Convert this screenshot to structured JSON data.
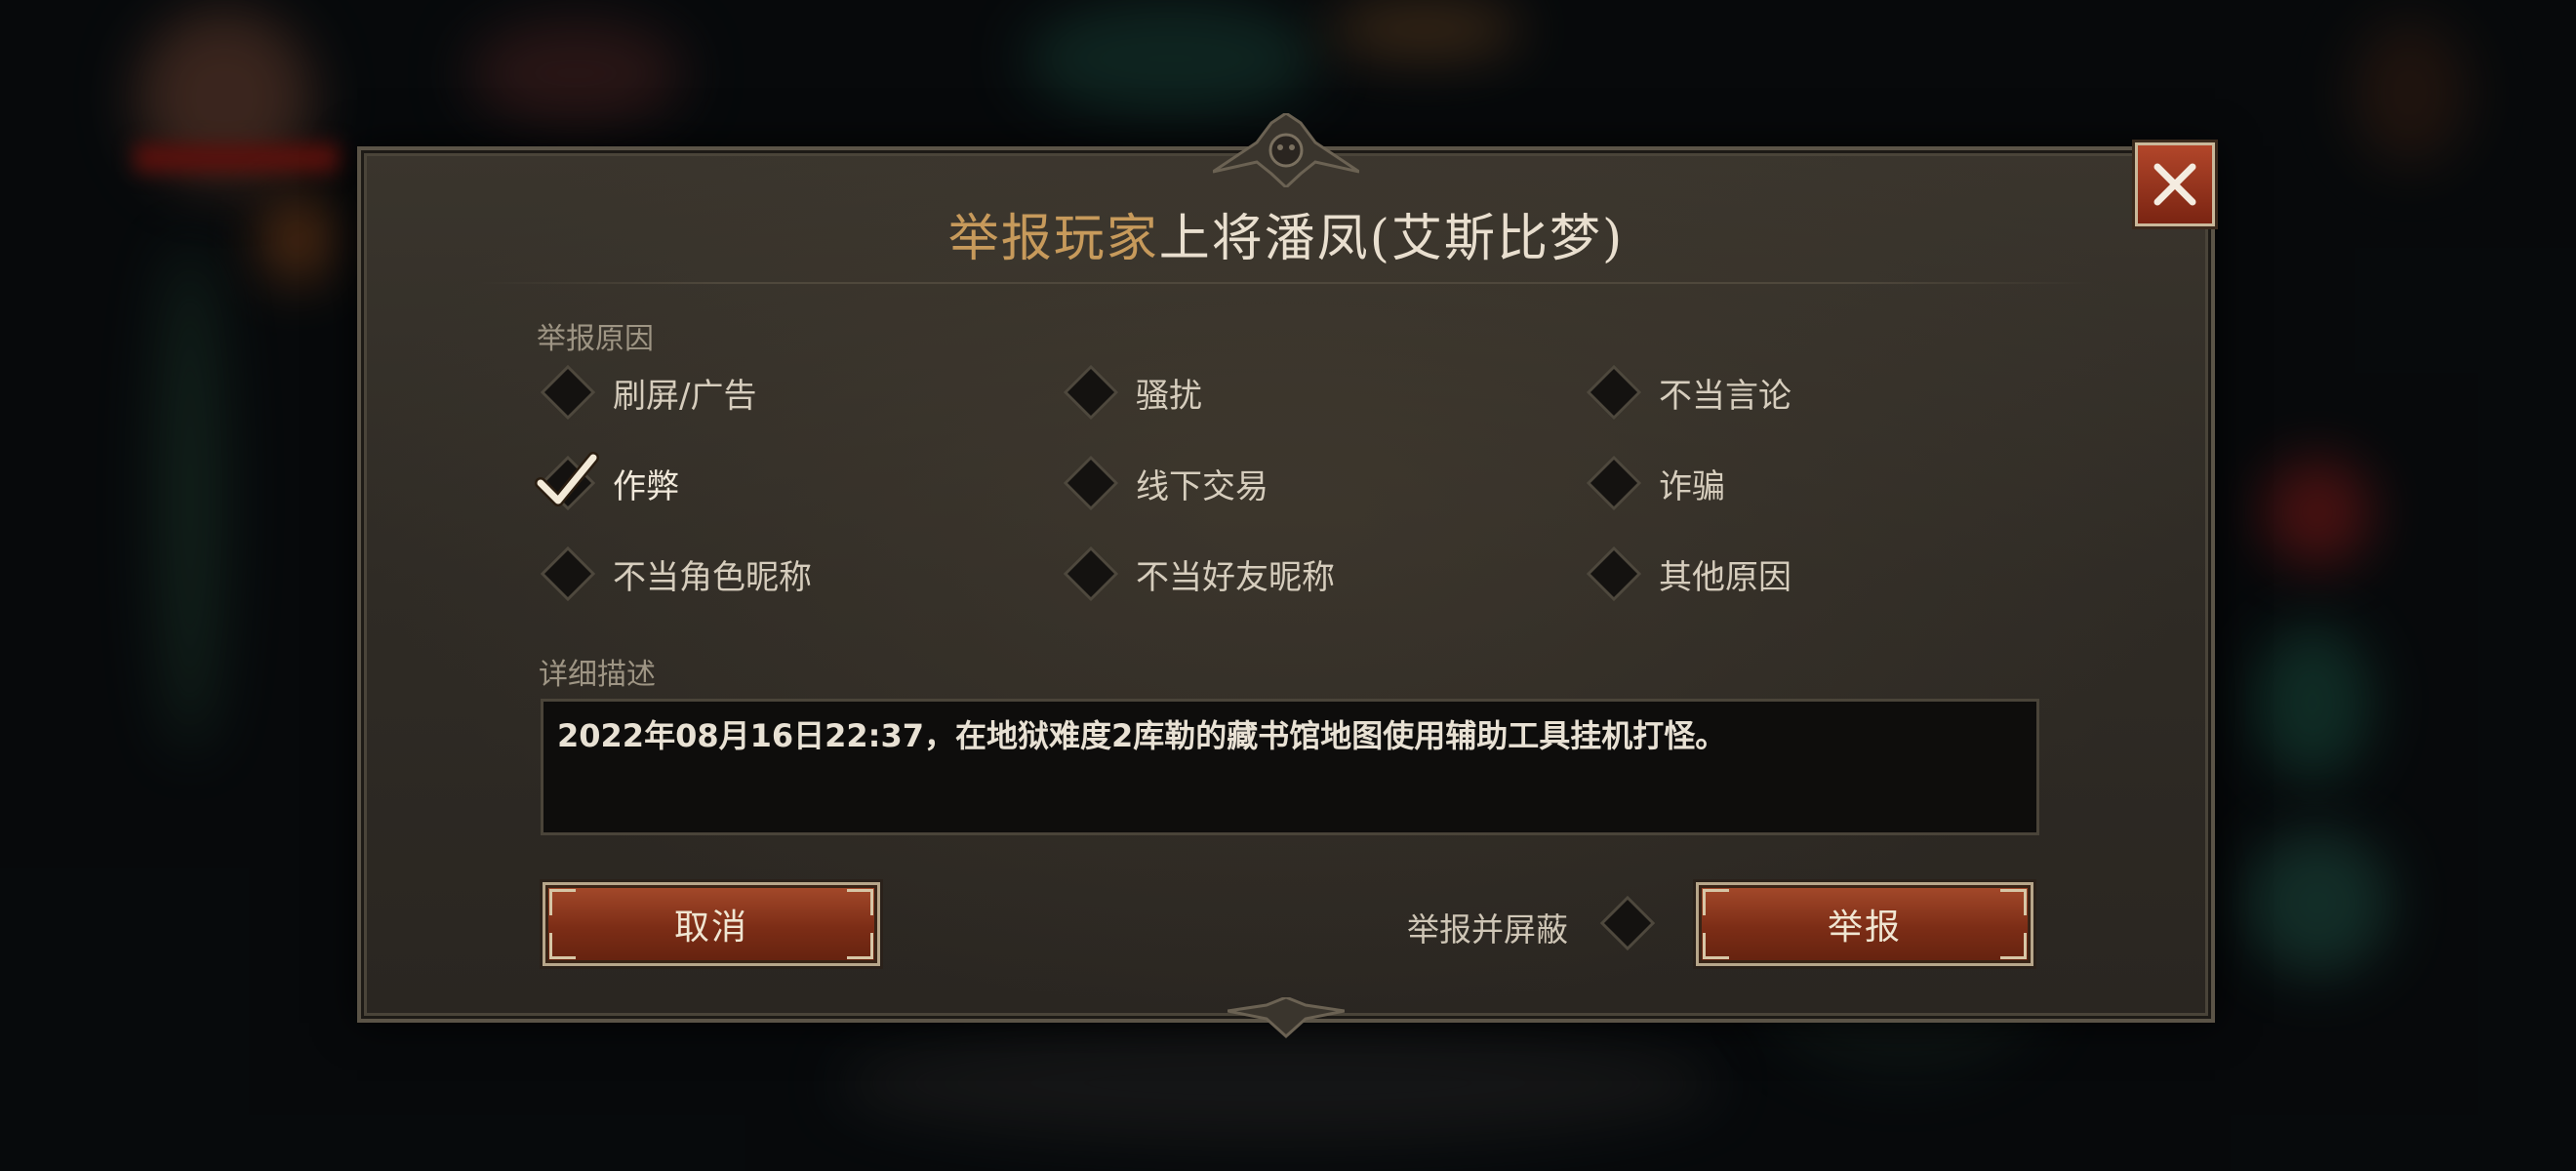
{
  "dialog": {
    "title_prefix": "举报玩家",
    "title_name": "上将潘凤(艾斯比梦)",
    "reasons_label": "举报原因",
    "reasons": [
      {
        "label": "刷屏/广告",
        "checked": false
      },
      {
        "label": "骚扰",
        "checked": false
      },
      {
        "label": "不当言论",
        "checked": false
      },
      {
        "label": "作弊",
        "checked": true
      },
      {
        "label": "线下交易",
        "checked": false
      },
      {
        "label": "诈骗",
        "checked": false
      },
      {
        "label": "不当角色昵称",
        "checked": false
      },
      {
        "label": "不当好友昵称",
        "checked": false
      },
      {
        "label": "其他原因",
        "checked": false
      }
    ],
    "description_label": "详细描述",
    "description_text": "2022年08月16日22:37，在地狱难度2库勒的藏书馆地图使用辅助工具挂机打怪。",
    "cancel_label": "取消",
    "block_label": "举报并屏蔽",
    "block_checked": false,
    "report_label": "举报"
  },
  "colors": {
    "title_prefix": "#c79a5b",
    "title_name": "#e9dfcf",
    "button_red": "#8a3219",
    "close_red": "#a53a20"
  }
}
